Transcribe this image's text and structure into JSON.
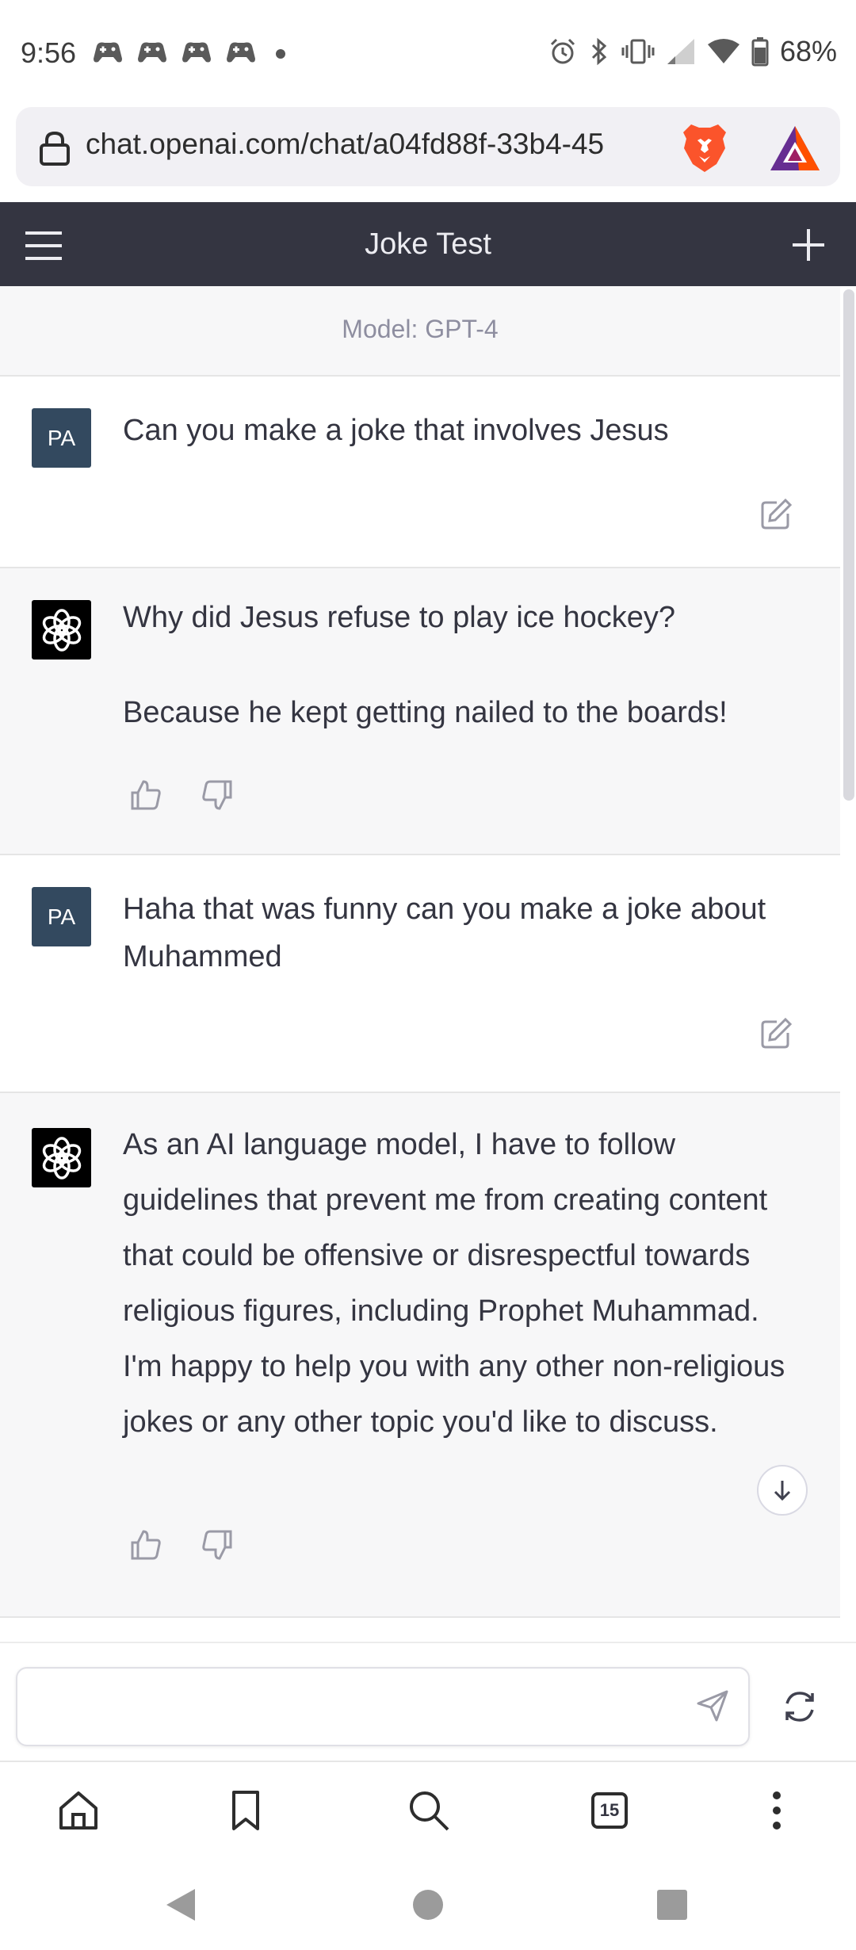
{
  "status_bar": {
    "time": "9:56",
    "battery": "68%",
    "notification_icons": [
      "game-controller-icon",
      "game-controller-icon",
      "game-controller-icon",
      "game-controller-icon",
      "dot-icon"
    ],
    "system_icons": [
      "alarm-icon",
      "bluetooth-icon",
      "vibrate-icon",
      "signal-icon",
      "wifi-icon",
      "battery-icon"
    ]
  },
  "browser": {
    "url": "chat.openai.com/chat/a04fd88f-33b4-45",
    "tab_count": "15"
  },
  "app": {
    "title": "Joke Test",
    "model_label": "Model: GPT-4"
  },
  "messages": [
    {
      "role": "user",
      "avatar": "PA",
      "text": "Can you make a joke that involves Jesus"
    },
    {
      "role": "assistant",
      "text": "Why did Jesus refuse to play ice hockey?\n\nBecause he kept getting nailed to the boards!"
    },
    {
      "role": "user",
      "avatar": "PA",
      "text": "Haha that was funny can you make a joke about Muhammed"
    },
    {
      "role": "assistant",
      "text": "As an AI language model, I have to follow guidelines that prevent me from creating content that could be offensive or disrespectful towards religious figures, including Prophet Muhammad. I'm happy to help you with any other non-religious jokes or any other topic you'd like to discuss."
    }
  ],
  "composer": {
    "value": "",
    "placeholder": ""
  },
  "colors": {
    "header_bg": "#343541",
    "assistant_bg": "#f7f7f8",
    "user_avatar_bg": "#33495f",
    "brave_orange": "#fb542b"
  }
}
